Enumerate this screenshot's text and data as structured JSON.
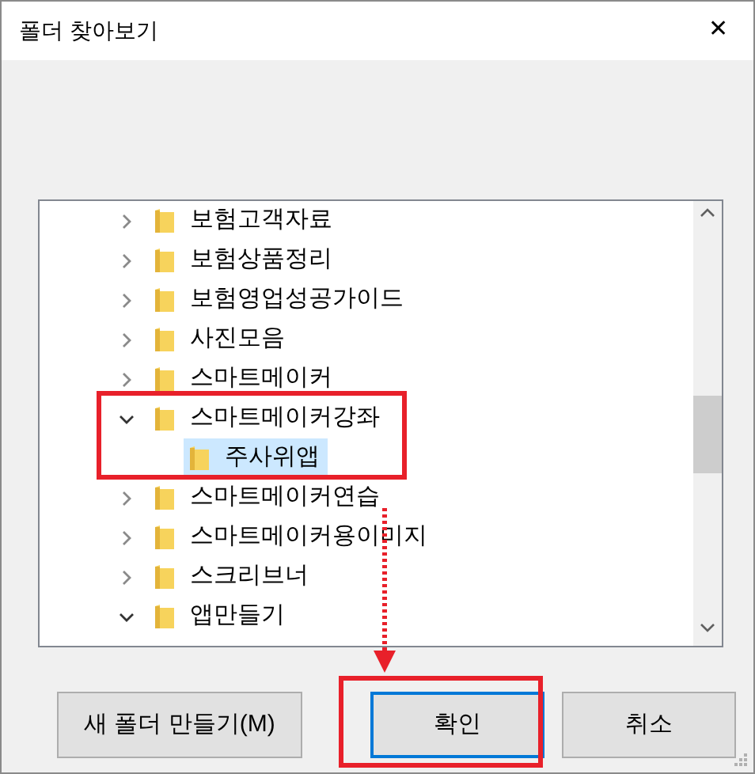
{
  "window": {
    "title": "폴더 찾아보기",
    "close": "✕"
  },
  "tree": [
    {
      "label": "보험고객자료",
      "expanded": false,
      "selected": false
    },
    {
      "label": "보험상품정리",
      "expanded": false,
      "selected": false
    },
    {
      "label": "보험영업성공가이드",
      "expanded": false,
      "selected": false
    },
    {
      "label": "사진모음",
      "expanded": false,
      "selected": false
    },
    {
      "label": "스마트메이커",
      "expanded": false,
      "selected": false
    },
    {
      "label": "스마트메이커강좌",
      "expanded": true,
      "selected": false,
      "children": [
        {
          "label": "주사위앱",
          "selected": true
        }
      ]
    },
    {
      "label": "스마트메이커연습",
      "expanded": false,
      "selected": false
    },
    {
      "label": "스마트메이커용이미지",
      "expanded": false,
      "selected": false
    },
    {
      "label": "스크리브너",
      "expanded": false,
      "selected": false
    },
    {
      "label": "앱만들기",
      "expanded": true,
      "selected": false
    }
  ],
  "buttons": [
    {
      "label": "새 폴더 만들기(M)",
      "default": false
    },
    {
      "label": "확인",
      "default": true
    },
    {
      "label": "취소",
      "default": false
    }
  ]
}
